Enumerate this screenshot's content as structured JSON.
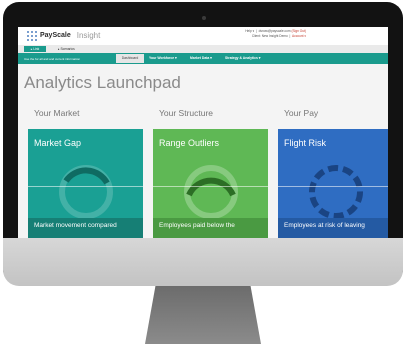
{
  "app": {
    "logo_text": "PayScale",
    "app_name": "Insight"
  },
  "user_menu": {
    "help_label": "Help ▾",
    "email": "dsnow@payscale.com",
    "sign_out": "(Sign Out)",
    "client": "Client: New Insight Demo",
    "account": "Account ▾"
  },
  "subbar": {
    "link_label": "▸ Link",
    "scenarios_label": "▸ Scenarios"
  },
  "nav": {
    "hint": "Use the for all and and current information",
    "dashboard": "Dashboard",
    "workforce": "Your Workforce ▾",
    "market": "Market Data ▾",
    "strategy": "Strategy & Analytics ▾"
  },
  "page": {
    "title": "Analytics Launchpad"
  },
  "sections": {
    "market": "Your Market",
    "structure": "Your Structure",
    "pay": "Your Pay"
  },
  "cards": [
    {
      "title": "Market Gap",
      "footer": "Market movement compared",
      "color": "#1aa094",
      "foot_color": "#167f75"
    },
    {
      "title": "Range Outliers",
      "footer": "Employees paid below the",
      "color": "#5fb855",
      "foot_color": "#4a9a42"
    },
    {
      "title": "Flight Risk",
      "footer": "Employees at risk of leaving",
      "color": "#2f6dc2",
      "foot_color": "#245aa3"
    }
  ]
}
